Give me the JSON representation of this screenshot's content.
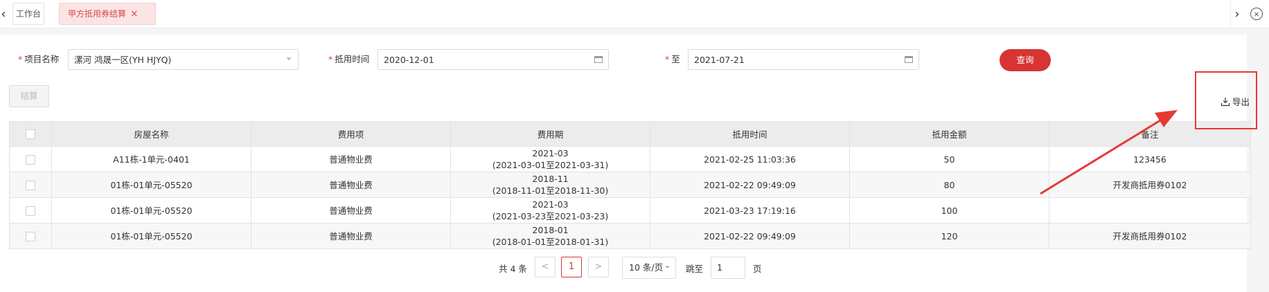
{
  "tabs": {
    "home": "工作台",
    "active": "甲方抵用券结算",
    "close_glyph": "×"
  },
  "filters": {
    "project_label": "项目名称",
    "project_value": "漯河 鸿晟一区(YH HJYQ)",
    "time_label": "抵用时间",
    "start_date": "2020-12-01",
    "to_label": "至",
    "end_date": "2021-07-21",
    "required_mark": "*"
  },
  "actions": {
    "query": "查询",
    "settle": "结算",
    "export": "导出"
  },
  "table": {
    "columns": [
      "房屋名称",
      "费用项",
      "费用期",
      "抵用时间",
      "抵用金额",
      "备注"
    ],
    "rows": [
      {
        "house": "A11栋-1单元-0401",
        "item": "普通物业费",
        "period": "2021-03",
        "period_range": "(2021-03-01至2021-03-31)",
        "time": "2021-02-25 11:03:36",
        "amount": "50",
        "remark": "123456"
      },
      {
        "house": "01栋-01单元-05520",
        "item": "普通物业费",
        "period": "2018-11",
        "period_range": "(2018-11-01至2018-11-30)",
        "time": "2021-02-22 09:49:09",
        "amount": "80",
        "remark": "开发商抵用券0102"
      },
      {
        "house": "01栋-01单元-05520",
        "item": "普通物业费",
        "period": "2021-03",
        "period_range": "(2021-03-23至2021-03-23)",
        "time": "2021-03-23 17:19:16",
        "amount": "100",
        "remark": ""
      },
      {
        "house": "01栋-01单元-05520",
        "item": "普通物业费",
        "period": "2018-01",
        "period_range": "(2018-01-01至2018-01-31)",
        "time": "2021-02-22 09:49:09",
        "amount": "120",
        "remark": "开发商抵用券0102"
      }
    ]
  },
  "pagination": {
    "total_text": "共 4 条",
    "prev": "<",
    "current": "1",
    "next": ">",
    "page_size": "10 条/页",
    "jump_label": "跳至",
    "jump_value": "1",
    "page_unit": "页"
  },
  "colors": {
    "accent": "#d83434",
    "annotation": "#e53935"
  }
}
